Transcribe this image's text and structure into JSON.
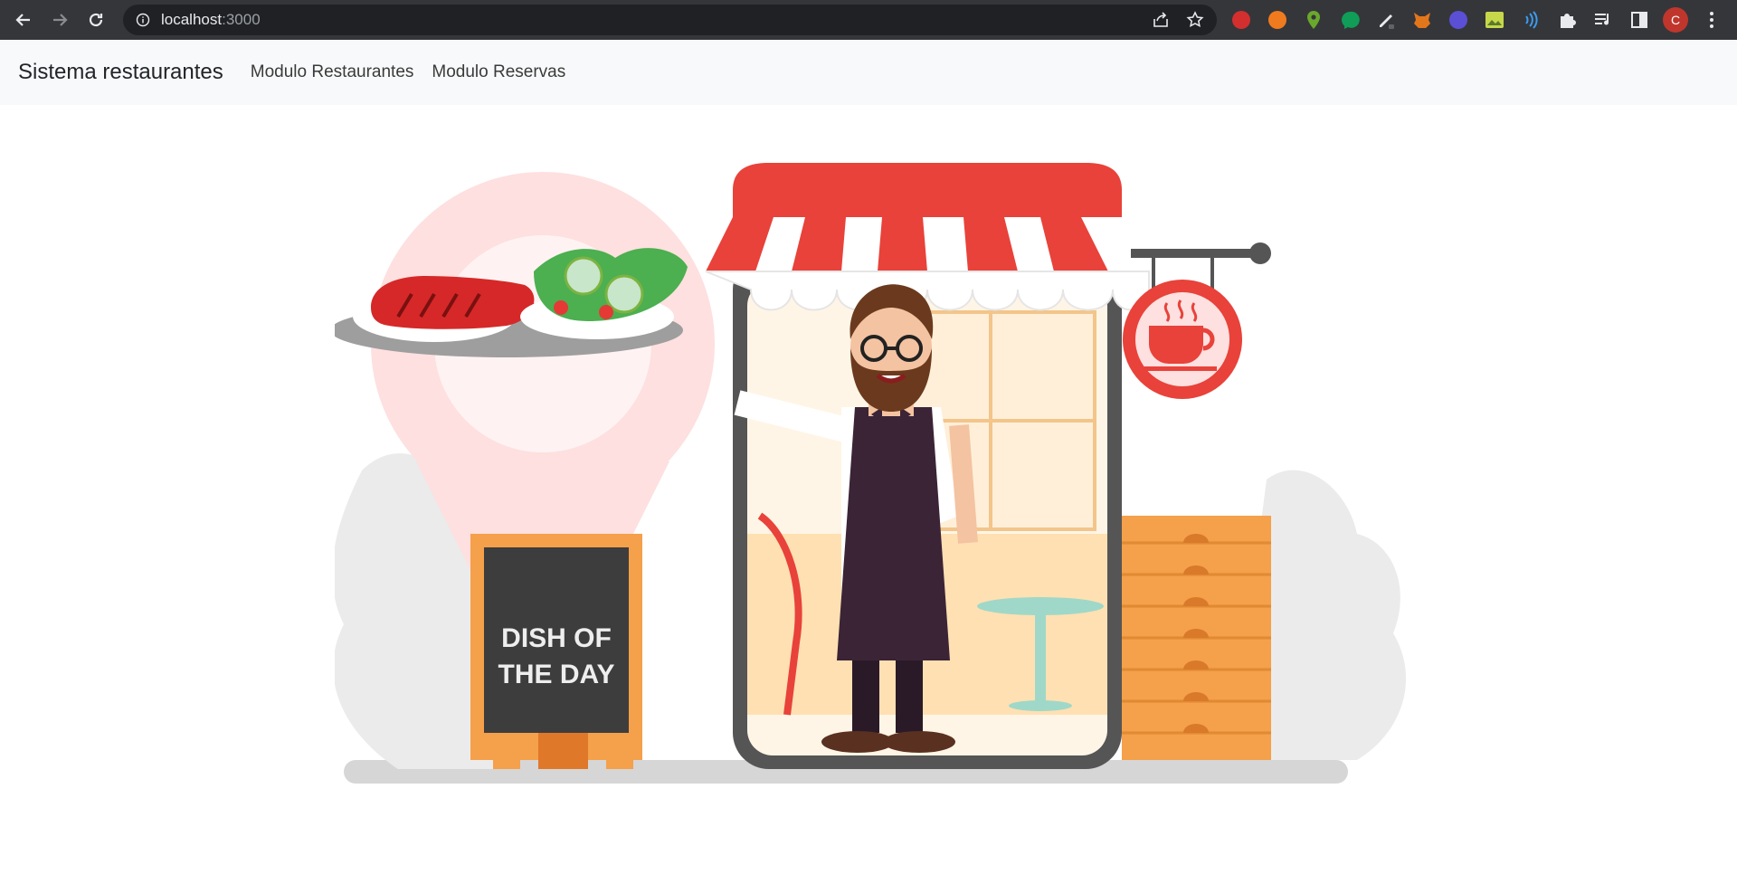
{
  "browser": {
    "url_host": "localhost",
    "url_port": ":3000",
    "profile_initial": "C",
    "colors": {
      "frame": "#35363a",
      "omnibox": "#202124"
    },
    "extensions": [
      "hand-stop-icon",
      "rss-icon",
      "map-pin-icon",
      "chat-bubble-icon",
      "pen-icon",
      "fox-icon",
      "face-icon",
      "picture-icon",
      "wireless-icon",
      "puzzle-icon",
      "playlist-icon",
      "sidepanel-icon"
    ]
  },
  "navbar": {
    "brand": "Sistema restaurantes",
    "links": [
      "Modulo Restaurantes",
      "Modulo Reservas"
    ]
  },
  "hero": {
    "chalkboard_line1": "DISH OF",
    "chalkboard_line2": "THE DAY",
    "colors": {
      "awning_red": "#e8423a",
      "chalkboard": "#3d3d3d",
      "orange": "#f5a04a",
      "apron": "#3b2436"
    }
  }
}
